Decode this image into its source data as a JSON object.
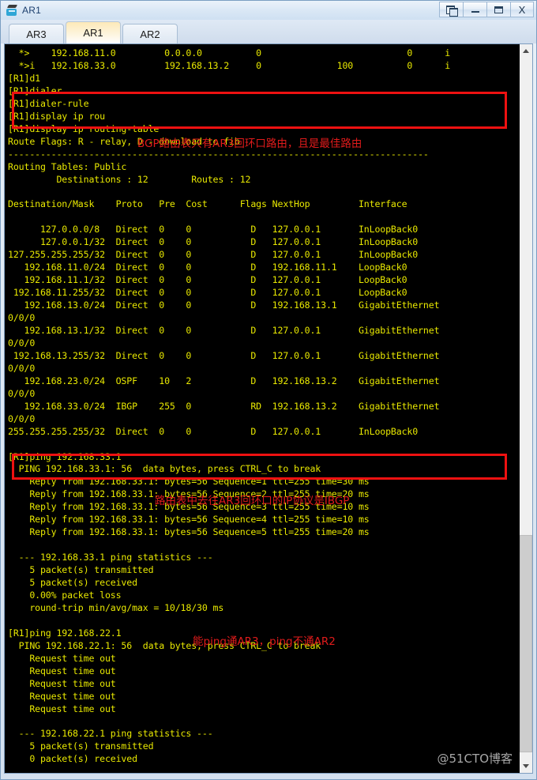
{
  "window": {
    "title": "AR1",
    "app_icon": "router-icon",
    "buttons": [
      {
        "name": "restore-button",
        "icon": "restore-icon",
        "label": ""
      },
      {
        "name": "minimize-button",
        "icon": "minimize-icon",
        "label": ""
      },
      {
        "name": "maximize-button",
        "icon": "maximize-icon",
        "label": ""
      },
      {
        "name": "close-button",
        "icon": "close-icon",
        "label": "X"
      }
    ]
  },
  "tabs": [
    {
      "label": "AR3",
      "active": false
    },
    {
      "label": "AR1",
      "active": true
    },
    {
      "label": "AR2",
      "active": false
    }
  ],
  "terminal": {
    "text": "  *>    192.168.11.0         0.0.0.0          0                           0      i\n  *>i   192.168.33.0         192.168.13.2     0              100          0      i\n[R1]d1\n[R1]dialer\n[R1]dialer-rule\n[R1]display ip rou\n[R1]display ip routing-table\nRoute Flags: R - relay, D - download to fib\n------------------------------------------------------------------------------\nRouting Tables: Public\n         Destinations : 12        Routes : 12\n\nDestination/Mask    Proto   Pre  Cost      Flags NextHop         Interface\n\n      127.0.0.0/8   Direct  0    0           D   127.0.0.1       InLoopBack0\n      127.0.0.1/32  Direct  0    0           D   127.0.0.1       InLoopBack0\n127.255.255.255/32  Direct  0    0           D   127.0.0.1       InLoopBack0\n   192.168.11.0/24  Direct  0    0           D   192.168.11.1    LoopBack0\n   192.168.11.1/32  Direct  0    0           D   127.0.0.1       LoopBack0\n 192.168.11.255/32  Direct  0    0           D   127.0.0.1       LoopBack0\n   192.168.13.0/24  Direct  0    0           D   192.168.13.1    GigabitEthernet\n0/0/0\n   192.168.13.1/32  Direct  0    0           D   127.0.0.1       GigabitEthernet\n0/0/0\n 192.168.13.255/32  Direct  0    0           D   127.0.0.1       GigabitEthernet\n0/0/0\n   192.168.23.0/24  OSPF    10   2           D   192.168.13.2    GigabitEthernet\n0/0/0\n   192.168.33.0/24  IBGP    255  0           RD  192.168.13.2    GigabitEthernet\n0/0/0\n255.255.255.255/32  Direct  0    0           D   127.0.0.1       InLoopBack0\n\n[R1]ping 192.168.33.1\n  PING 192.168.33.1: 56  data bytes, press CTRL_C to break\n    Reply from 192.168.33.1: bytes=56 Sequence=1 ttl=255 time=30 ms\n    Reply from 192.168.33.1: bytes=56 Sequence=2 ttl=255 time=20 ms\n    Reply from 192.168.33.1: bytes=56 Sequence=3 ttl=255 time=10 ms\n    Reply from 192.168.33.1: bytes=56 Sequence=4 ttl=255 time=10 ms\n    Reply from 192.168.33.1: bytes=56 Sequence=5 ttl=255 time=20 ms\n\n  --- 192.168.33.1 ping statistics ---\n    5 packet(s) transmitted\n    5 packet(s) received\n    0.00% packet loss\n    round-trip min/avg/max = 10/18/30 ms\n\n[R1]ping 192.168.22.1\n  PING 192.168.22.1: 56  data bytes, press CTRL_C to break\n    Request time out\n    Request time out\n    Request time out\n    Request time out\n    Request time out\n\n  --- 192.168.22.1 ping statistics ---\n    5 packet(s) transmitted\n    0 packet(s) received",
    "text_color": "#e8e800",
    "background_color": "#000000"
  },
  "annotations": [
    {
      "id": "bgp-table-note",
      "text": "BGP路由表只有AR3回环口路由，且是最佳路由",
      "color": "#e01b1b"
    },
    {
      "id": "ibgp-route-note",
      "text": "路由表中去往AR3回环口的IP协议是IBGP",
      "color": "#e01b1b"
    },
    {
      "id": "ping-result-note",
      "text": "能ping通AR3，ping不通AR2",
      "color": "#e01b1b"
    }
  ],
  "highlights": [
    {
      "id": "bgp-rows-highlight",
      "color": "#ee1111"
    },
    {
      "id": "ibgp-row-highlight",
      "color": "#ee1111"
    }
  ],
  "watermark": {
    "text": "@51CTO博客"
  },
  "scrollbar": {
    "up_arrow": "chevron-up-icon",
    "down_arrow": "chevron-down-icon"
  }
}
